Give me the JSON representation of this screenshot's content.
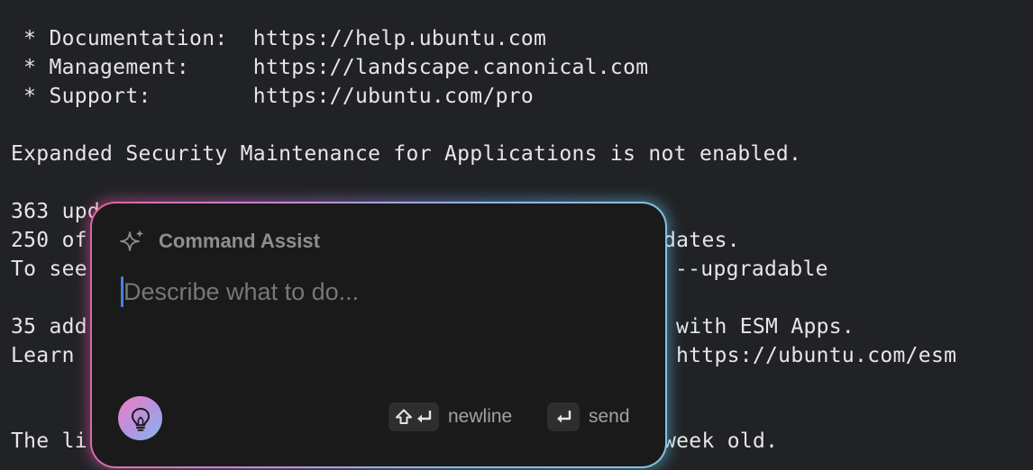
{
  "terminal": {
    "lines": [
      " * Documentation:  https://help.ubuntu.com",
      " * Management:     https://landscape.canonical.com",
      " * Support:        https://ubuntu.com/pro",
      "Expanded Security Maintenance for Applications is not enabled.",
      "363 upd",
      "250 of",
      "To see",
      "35 add",
      "Learn",
      "The li",
      "dates.",
      "--upgradable",
      "with ESM Apps.",
      "https://ubuntu.com/esm",
      "week old."
    ]
  },
  "assist": {
    "title": "Command Assist",
    "placeholder": "Describe what to do...",
    "newline_label": "newline",
    "send_label": "send"
  },
  "icons": {
    "header": "sparkle-icon",
    "assist_button": "lightbulb-icon",
    "shift": "shift-icon",
    "return": "return-icon"
  },
  "colors": {
    "terminal_bg": "#202225",
    "terminal_fg": "#e6e6e6",
    "popup_bg": "#1a1a1b",
    "caret": "#4a7fe0",
    "gradient_pink": "#e2609f",
    "gradient_blue": "#7fc4de"
  }
}
